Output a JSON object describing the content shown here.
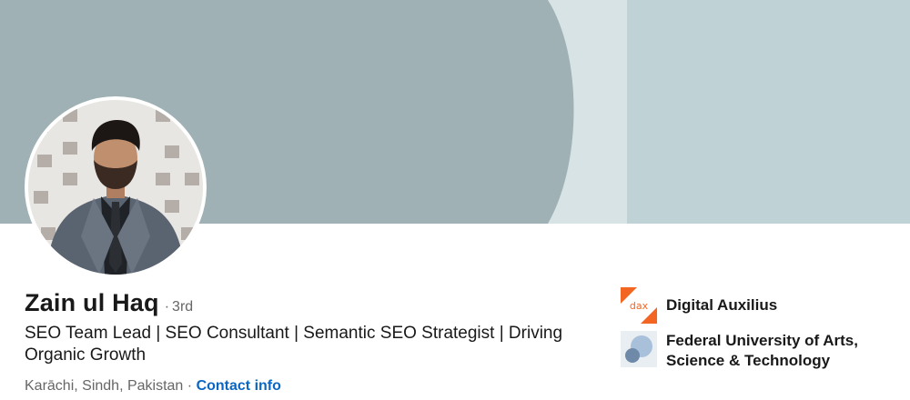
{
  "profile": {
    "name": "Zain ul Haq",
    "degree": "3rd",
    "headline": "SEO Team Lead | SEO Consultant | Semantic SEO Strategist | Driving Organic Growth",
    "location": "Karāchi, Sindh, Pakistan",
    "contact_label": "Contact info"
  },
  "organizations": [
    {
      "name": "Digital Auxilius",
      "logo": "digital-auxilius-logo",
      "logo_text": "dax"
    },
    {
      "name": "Federal University of Arts, Science & Technology",
      "logo": "federal-university-logo"
    }
  ],
  "colors": {
    "cover_dark": "#9fb1b4",
    "cover_light": "#bfd2d6",
    "cover_stripe": "#d8e3e6",
    "link": "#0a66c2",
    "text": "#191919",
    "muted": "#666666",
    "dax_orange": "#f26522"
  }
}
